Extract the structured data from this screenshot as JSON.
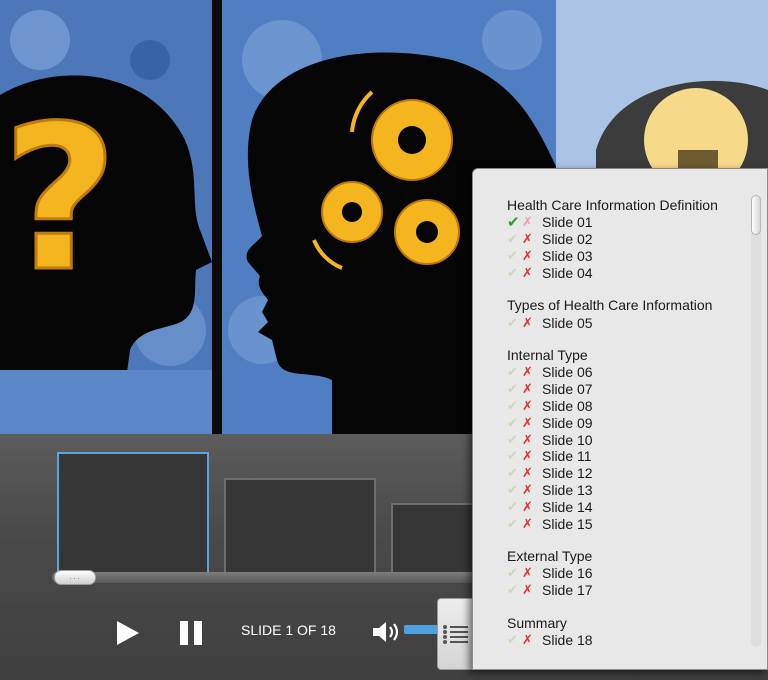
{
  "player": {
    "slide_counter": "SLIDE 1 OF 18",
    "scrub_grip": "···",
    "accent_color": "#4ea0dd"
  },
  "icons": {
    "play": "play-icon",
    "pause": "pause-icon",
    "volume": "volume-icon",
    "menu": "outline-menu-icon"
  },
  "outline": {
    "sections": [
      {
        "title": "Health Care Information Definition",
        "slides": [
          {
            "label": "Slide 01",
            "viewed": true
          },
          {
            "label": "Slide 02",
            "viewed": false
          },
          {
            "label": "Slide 03",
            "viewed": false
          },
          {
            "label": "Slide 04",
            "viewed": false
          }
        ]
      },
      {
        "title": "Types of Health Care Information",
        "slides": [
          {
            "label": "Slide 05",
            "viewed": false
          }
        ]
      },
      {
        "title": "Internal Type",
        "slides": [
          {
            "label": "Slide 06",
            "viewed": false
          },
          {
            "label": "Slide 07",
            "viewed": false
          },
          {
            "label": "Slide 08",
            "viewed": false
          },
          {
            "label": "Slide 09",
            "viewed": false
          },
          {
            "label": "Slide 10",
            "viewed": false
          },
          {
            "label": "Slide 11",
            "viewed": false
          },
          {
            "label": "Slide 12",
            "viewed": false
          },
          {
            "label": "Slide 13",
            "viewed": false
          },
          {
            "label": "Slide 14",
            "viewed": false
          },
          {
            "label": "Slide 15",
            "viewed": false
          }
        ]
      },
      {
        "title": "External Type",
        "slides": [
          {
            "label": "Slide 16",
            "viewed": false
          },
          {
            "label": "Slide 17",
            "viewed": false
          }
        ]
      },
      {
        "title": "Summary",
        "slides": [
          {
            "label": "Slide 18",
            "viewed": false
          }
        ]
      }
    ]
  }
}
